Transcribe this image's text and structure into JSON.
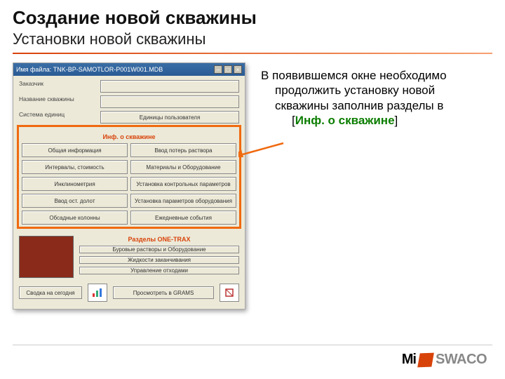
{
  "title": "Создание новой скважины",
  "subtitle": "Установки новой скважины",
  "window": {
    "titlebar": "Имя файла: TNK-BP-SAMOTLOR-P001W001.MDB",
    "labels": {
      "zakaz": "Заказчик",
      "nazv": "Название скважины",
      "sist": "Система единиц",
      "ed": "Единицы пользователя"
    },
    "section_info": "Инф. о скважине",
    "info_buttons": [
      "Общая информация",
      "Ввод потерь раствора",
      "Интервалы, стоимость",
      "Материалы и Оборудование",
      "Инклинометрия",
      "Установка контрольных параметров",
      "Ввод ост. долот",
      "Установка параметров оборудования",
      "Обсадные колонны",
      "Ежедневные события"
    ],
    "section_one": "Разделы ONE-TRAX",
    "one_buttons": [
      "Буровые растворы и Оборудование",
      "Жидкости заканчивания",
      "Управление отходами"
    ],
    "footer": {
      "today": "Сводка на сегодня",
      "view": "Просмотреть в GRAMS"
    }
  },
  "explain": {
    "line1": "В появившемся окне необходимо",
    "line2": "продолжить установку новой",
    "line3": "скважины заполнив разделы в",
    "br_open": "[",
    "link": "Инф. о скважине",
    "br_close": "]"
  },
  "logo": {
    "mi": "Mi",
    "sw": "SWACO"
  }
}
